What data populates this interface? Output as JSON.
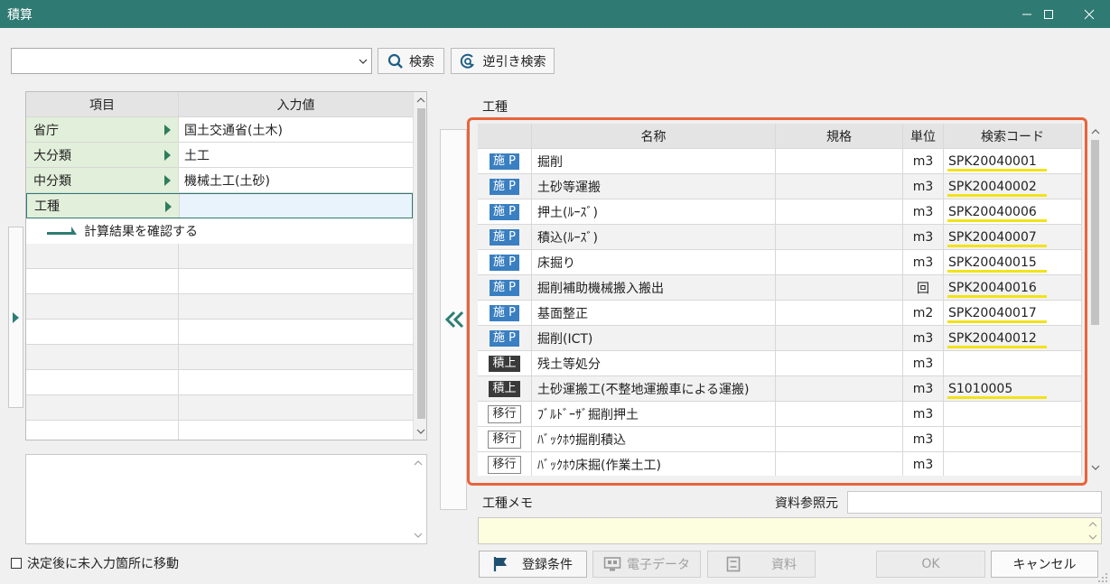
{
  "window": {
    "title": "積算"
  },
  "toolbar": {
    "search_value": "",
    "search_label": "検索",
    "reverse_search_label": "逆引き検索"
  },
  "left_grid": {
    "headers": [
      "項目",
      "入力値"
    ],
    "rows": [
      {
        "label": "省庁",
        "value": "国土交通省(土木)"
      },
      {
        "label": "大分類",
        "value": "土工"
      },
      {
        "label": "中分類",
        "value": "機械土工(土砂)"
      },
      {
        "label": "工種",
        "value": ""
      }
    ],
    "confirm_text": "計算結果を確認する"
  },
  "right_panel": {
    "section_label": "工種",
    "headers": [
      "名称",
      "規格",
      "単位",
      "検索コード"
    ],
    "rows": [
      {
        "tag": "施 P",
        "name": "掘削",
        "spec": "",
        "unit": "m3",
        "code": "SPK20040001"
      },
      {
        "tag": "施 P",
        "name": "土砂等運搬",
        "spec": "",
        "unit": "m3",
        "code": "SPK20040002"
      },
      {
        "tag": "施 P",
        "name": "押土(ﾙｰｽﾞ)",
        "spec": "",
        "unit": "m3",
        "code": "SPK20040006"
      },
      {
        "tag": "施 P",
        "name": "積込(ﾙｰｽﾞ)",
        "spec": "",
        "unit": "m3",
        "code": "SPK20040007"
      },
      {
        "tag": "施 P",
        "name": "床掘り",
        "spec": "",
        "unit": "m3",
        "code": "SPK20040015"
      },
      {
        "tag": "施 P",
        "name": "掘削補助機械搬入搬出",
        "spec": "",
        "unit": "回",
        "code": "SPK20040016"
      },
      {
        "tag": "施 P",
        "name": "基面整正",
        "spec": "",
        "unit": "m2",
        "code": "SPK20040017"
      },
      {
        "tag": "施 P",
        "name": "掘削(ICT)",
        "spec": "",
        "unit": "m3",
        "code": "SPK20040012"
      },
      {
        "tag": "積上",
        "name": "残土等処分",
        "spec": "",
        "unit": "m3",
        "code": ""
      },
      {
        "tag": "積上",
        "name": "土砂運搬工(不整地運搬車による運搬)",
        "spec": "",
        "unit": "m3",
        "code": "S1010005"
      },
      {
        "tag": "移行",
        "name": "ﾌﾞﾙﾄﾞｰｻﾞ掘削押土",
        "spec": "",
        "unit": "m3",
        "code": ""
      },
      {
        "tag": "移行",
        "name": "ﾊﾞｯｸﾎｳ掘削積込",
        "spec": "",
        "unit": "m3",
        "code": ""
      },
      {
        "tag": "移行",
        "name": "ﾊﾞｯｸﾎｳ床掘(作業土工)",
        "spec": "",
        "unit": "m3",
        "code": ""
      }
    ],
    "memo_label": "工種メモ",
    "reference_label": "資料参照元",
    "reference_value": "",
    "memo_value": ""
  },
  "footer": {
    "move_checkbox_label": "決定後に未入力箇所に移動",
    "move_checkbox_checked": false,
    "register_label": "登録条件",
    "edata_label": "電子データ",
    "material_label": "資料",
    "ok_label": "OK",
    "cancel_label": "キャンセル"
  },
  "colors": {
    "titlebar": "#2f7a73",
    "highlight_frame": "#e8643a",
    "code_underline": "#f2e21a",
    "tag_construction": "#3a7fc1",
    "tag_estimate": "#3a3a3a"
  }
}
